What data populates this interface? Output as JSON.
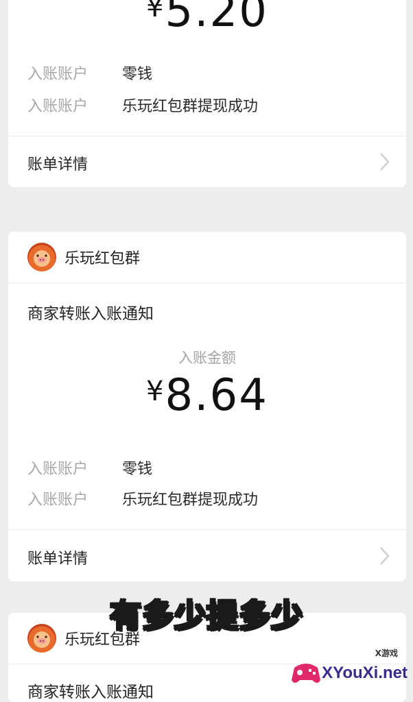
{
  "card1": {
    "amount_currency": "¥",
    "amount_value": "5.20",
    "rows": [
      {
        "key": "入账账户",
        "value": "零钱"
      },
      {
        "key": "入账账户",
        "value": "乐玩红包群提现成功"
      }
    ],
    "detail_label": "账单详情"
  },
  "card2": {
    "sender_name": "乐玩红包群",
    "notice_title": "商家转账入账通知",
    "amount_label": "入账金额",
    "amount_currency": "¥",
    "amount_value": "8.64",
    "rows": [
      {
        "key": "入账账户",
        "value": "零钱"
      },
      {
        "key": "入账账户",
        "value": "乐玩红包群提现成功"
      }
    ],
    "detail_label": "账单详情"
  },
  "card3": {
    "sender_name": "乐玩红包群",
    "notice_title": "商家转账入账通知"
  },
  "caption": "有多少提多少",
  "watermark": {
    "text": "XYouXi.net",
    "small": "X游戏"
  },
  "colors": {
    "background": "#ededed",
    "card": "#ffffff",
    "muted_text": "#a7a7a7",
    "caption_fill": "#ffe01b"
  },
  "icons": [
    "chevron-right-icon",
    "avatar-pig-icon"
  ]
}
